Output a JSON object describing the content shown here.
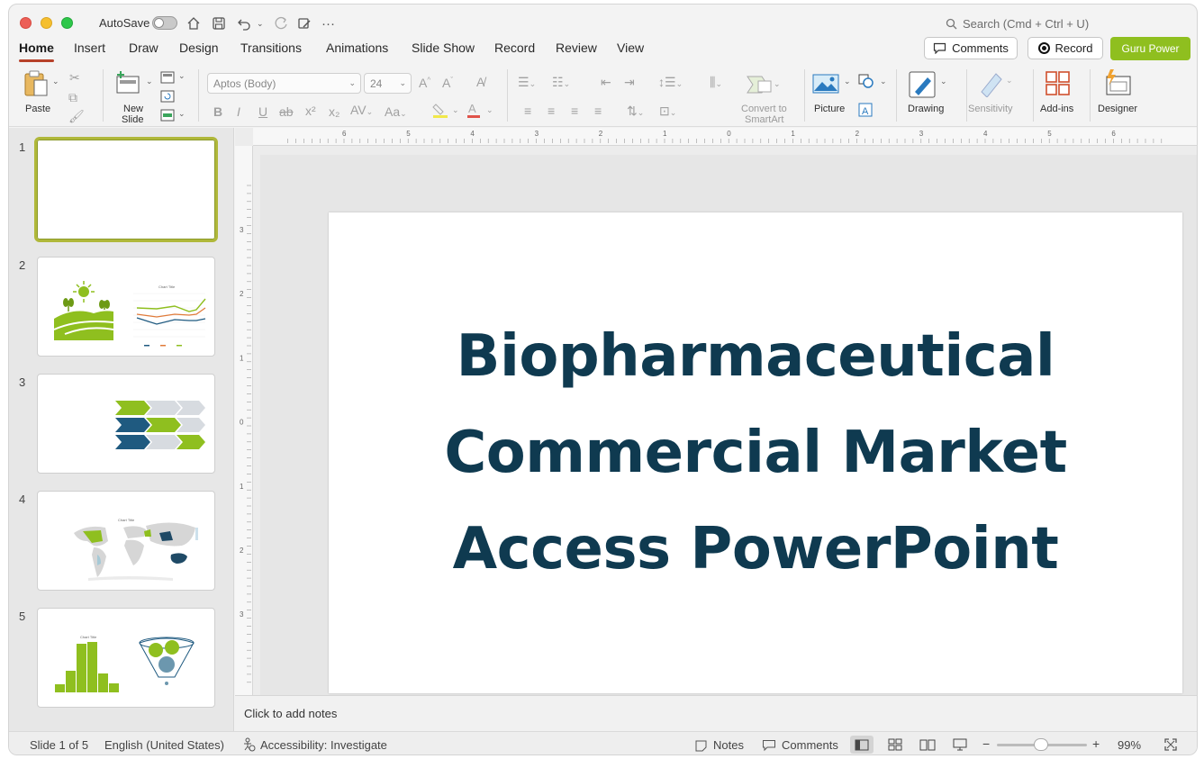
{
  "titlebar": {
    "autosave_label": "AutoSave",
    "search_placeholder": "Search (Cmd + Ctrl + U)"
  },
  "tabs": [
    "Home",
    "Insert",
    "Draw",
    "Design",
    "Transitions",
    "Animations",
    "Slide Show",
    "Record",
    "Review",
    "View"
  ],
  "header_buttons": {
    "comments": "Comments",
    "record": "Record",
    "guru": "Guru Power"
  },
  "ribbon": {
    "paste": "Paste",
    "new_slide_1": "New",
    "new_slide_2": "Slide",
    "font_name": "Aptos (Body)",
    "font_size": "24",
    "convert_1": "Convert to",
    "convert_2": "SmartArt",
    "picture": "Picture",
    "drawing": "Drawing",
    "sensitivity": "Sensitivity",
    "addins": "Add-ins",
    "designer": "Designer"
  },
  "slides": [
    "1",
    "2",
    "3",
    "4",
    "5"
  ],
  "thumb_text": {
    "chart_title": "Chart Title"
  },
  "ruler": {
    "h_ticks": [
      "6",
      "5",
      "4",
      "3",
      "2",
      "1",
      "0",
      "1",
      "2",
      "3",
      "4",
      "5",
      "6"
    ],
    "v_ticks": [
      "3",
      "2",
      "1",
      "0",
      "1",
      "2",
      "3"
    ]
  },
  "slide": {
    "title_line1": "Biopharmaceutical",
    "title_line2": "Commercial Market",
    "title_line3": "Access PowerPoint"
  },
  "notes_placeholder": "Click to add notes",
  "status": {
    "slide_info": "Slide 1 of 5",
    "language": "English (United States)",
    "accessibility": "Accessibility: Investigate",
    "notes": "Notes",
    "comments": "Comments",
    "zoom": "99%"
  },
  "colors": {
    "accent_green": "#8fbf1f",
    "title_navy": "#0f3a50",
    "tab_underline": "#b7412a"
  }
}
